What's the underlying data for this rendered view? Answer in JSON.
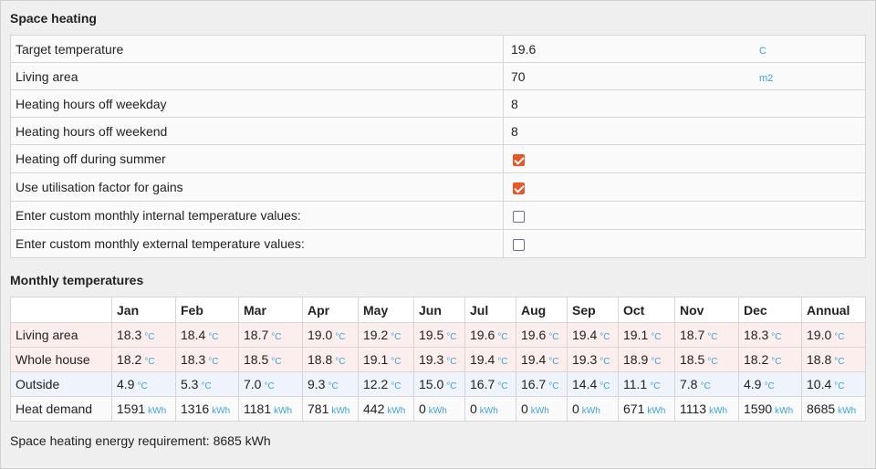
{
  "space_heating": {
    "title": "Space heating",
    "rows": [
      {
        "label": "Target temperature",
        "value": "19.6",
        "unit": "C"
      },
      {
        "label": "Living area",
        "value": "70",
        "unit": "m2"
      },
      {
        "label": "Heating hours off weekday",
        "value": "8",
        "unit": ""
      },
      {
        "label": "Heating hours off weekend",
        "value": "8",
        "unit": ""
      },
      {
        "label": "Heating off during summer",
        "checked": true
      },
      {
        "label": "Use utilisation factor for gains",
        "checked": true
      },
      {
        "label": "Enter custom monthly internal temperature values:",
        "checked": false
      },
      {
        "label": "Enter custom monthly external temperature values:",
        "checked": false
      }
    ]
  },
  "monthly": {
    "title": "Monthly temperatures",
    "columns": [
      "",
      "Jan",
      "Feb",
      "Mar",
      "Apr",
      "May",
      "Jun",
      "Jul",
      "Aug",
      "Sep",
      "Oct",
      "Nov",
      "Dec",
      "Annual"
    ],
    "rows": [
      {
        "label": "Living area",
        "unit": "°C",
        "values": [
          "18.3",
          "18.4",
          "18.7",
          "19.0",
          "19.2",
          "19.5",
          "19.6",
          "19.6",
          "19.4",
          "19.1",
          "18.7",
          "18.3",
          "19.0"
        ]
      },
      {
        "label": "Whole house",
        "unit": "°C",
        "values": [
          "18.2",
          "18.3",
          "18.5",
          "18.8",
          "19.1",
          "19.3",
          "19.4",
          "19.4",
          "19.3",
          "18.9",
          "18.5",
          "18.2",
          "18.8"
        ]
      },
      {
        "label": "Outside",
        "unit": "°C",
        "values": [
          "4.9",
          "5.3",
          "7.0",
          "9.3",
          "12.2",
          "15.0",
          "16.7",
          "16.7",
          "14.4",
          "11.1",
          "7.8",
          "4.9",
          "10.4"
        ]
      },
      {
        "label": "Heat demand",
        "unit": "kWh",
        "values": [
          "1591",
          "1316",
          "1181",
          "781",
          "442",
          "0",
          "0",
          "0",
          "0",
          "671",
          "1113",
          "1590",
          "8685"
        ]
      }
    ]
  },
  "footer": "Space heating energy requirement: 8685 kWh",
  "colors": {
    "accent": "#e8572a",
    "unit": "#37a5d8",
    "pink_row": "#fdeeee",
    "blue_row": "#eef3fc"
  }
}
